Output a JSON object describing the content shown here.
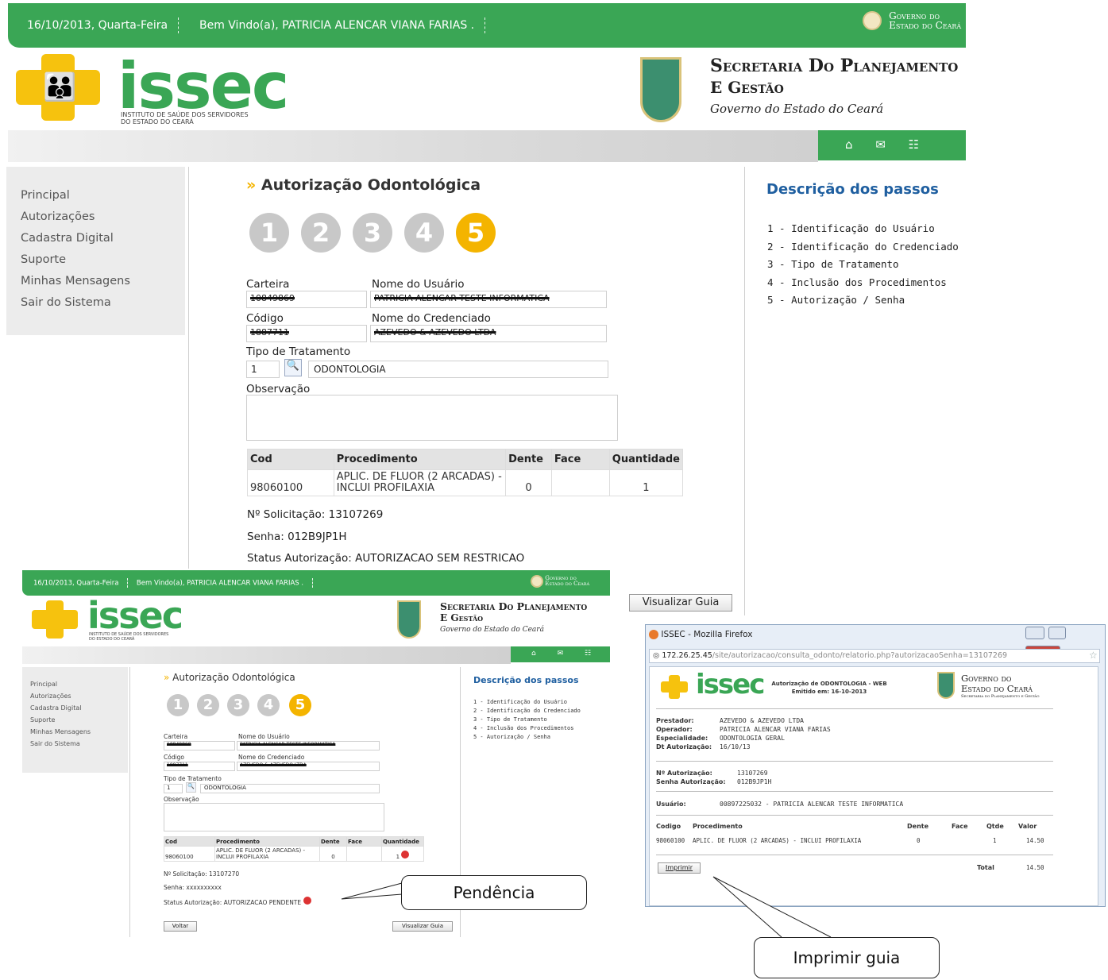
{
  "main": {
    "header": {
      "date": "16/10/2013, Quarta-Feira",
      "welcome": "Bem Vindo(a), PATRICIA ALENCAR VIANA FARIAS .",
      "gov_line1": "Governo do",
      "gov_line2": "Estado do Ceará"
    },
    "logo": {
      "word": "issec",
      "sub1": "INSTITUTO DE SAÚDE DOS SERVIDORES",
      "sub2": "DO ESTADO DO CEARÁ"
    },
    "secretaria": {
      "line1": "Secretaria Do Planejamento",
      "line2": "E Gestão",
      "line3": "Governo do Estado do Ceará"
    },
    "icons": {
      "home": "⌂",
      "mail": "✉",
      "sitemap": "☷"
    },
    "sidebar": [
      "Principal",
      "Autorizações",
      "Cadastra Digital",
      "Suporte",
      "Minhas Mensagens",
      "Sair do Sistema"
    ],
    "page_title": "Autorização Odontológica",
    "steps": [
      "1",
      "2",
      "3",
      "4",
      "5"
    ],
    "form": {
      "carteira_label": "Carteira",
      "carteira": "10849869",
      "usuario_label": "Nome do Usuário",
      "usuario": "PATRICIA ALENCAR TESTE INFORMATICA",
      "codigo_label": "Código",
      "codigo": "1887711",
      "credenciado_label": "Nome do Credenciado",
      "credenciado": "AZEVEDO & AZEVEDO LTDA",
      "tipo_label": "Tipo de Tratamento",
      "tipo_code": "1",
      "tipo_name": "ODONTOLOGIA",
      "obs_label": "Observação"
    },
    "table": {
      "headers": [
        "Cod",
        "Procedimento",
        "Dente",
        "Face",
        "Quantidade"
      ],
      "rows": [
        {
          "cod": "98060100",
          "proc": "APLIC. DE FLUOR (2 ARCADAS) - INCLUI PROFILAXIA",
          "dente": "0",
          "face": "",
          "qtd": "1"
        }
      ]
    },
    "solicitacao": "Nº Solicitação: 13107269",
    "senha": "Senha: 012B9JP1H",
    "status": "Status Autorização: AUTORIZACAO SEM RESTRICAO",
    "visualizar": "Visualizar Guia",
    "desc_title": "Descrição dos passos",
    "desc_steps": [
      "1 - Identificação do Usuário",
      "2 - Identificação do Credenciado",
      "3 - Tipo de Tratamento",
      "4 - Inclusão dos Procedimentos",
      "5 - Autorização / Senha"
    ]
  },
  "inset": {
    "solicitacao": "Nº Solicitação: 13107270",
    "senha": "Senha: xxxxxxxxxx",
    "status": "Status Autorização: AUTORIZACAO PENDENTE",
    "voltar": "Voltar",
    "visualizar": "Visualizar Guia"
  },
  "callouts": {
    "pendencia": "Pendência",
    "imprimir": "Imprimir guia"
  },
  "firefox": {
    "title": "ISSEC - Mozilla Firefox",
    "url_host": "172.26.25.45",
    "url_path": "/site/autorizacao/consulta_odonto/relatorio.php?autorizacaoSenha=13107269",
    "report_title1": "Autorização de ODONTOLOGIA - WEB",
    "report_title2": "Emitido em: 16-10-2013",
    "labels": {
      "prestador": "Prestador:",
      "operador": "Operador:",
      "especialidade": "Especialidade:",
      "dt": "Dt Autorização:",
      "n_aut": "Nº Autorização:",
      "senha_aut": "Senha Autorização:",
      "usuario": "Usuário:"
    },
    "values": {
      "prestador": "AZEVEDO & AZEVEDO LTDA",
      "operador": "PATRICIA ALENCAR VIANA FARIAS",
      "especialidade": "ODONTOLOGIA GERAL",
      "dt": "16/10/13",
      "n_aut": "13107269",
      "senha_aut": "012B9JP1H",
      "usuario": "00897225032 - PATRICIA ALENCAR TESTE INFORMATICA"
    },
    "headers": [
      "Codigo",
      "Procedimento",
      "Dente",
      "Face",
      "Qtde",
      "Valor"
    ],
    "row": {
      "codigo": "98060100",
      "proc": "APLIC. DE FLUOR (2 ARCADAS) - INCLUI PROFILAXIA",
      "dente": "0",
      "face": "",
      "qtde": "1",
      "valor": "14.50"
    },
    "total_label": "Total",
    "total": "14.50",
    "imprimir": "Imprimir",
    "secretaria_sub": "Secretaria do Planejamento e Gestão"
  }
}
